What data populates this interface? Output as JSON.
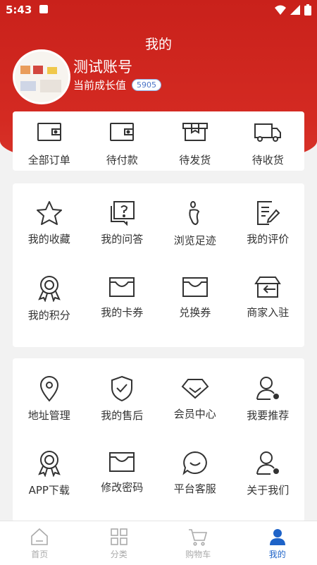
{
  "status": {
    "time": "5:43"
  },
  "header": {
    "title": "我的"
  },
  "profile": {
    "username": "测试账号",
    "growth_label": "当前成长值",
    "growth_value": "5905"
  },
  "orders": [
    {
      "label": "全部订单",
      "icon": "wallet-icon"
    },
    {
      "label": "待付款",
      "icon": "wallet-icon"
    },
    {
      "label": "待发货",
      "icon": "package-icon"
    },
    {
      "label": "待收货",
      "icon": "truck-icon"
    }
  ],
  "services1": [
    {
      "label": "我的收藏",
      "icon": "star-icon"
    },
    {
      "label": "我的问答",
      "icon": "question-icon"
    },
    {
      "label": "浏览足迹",
      "icon": "footprint-icon"
    },
    {
      "label": "我的评价",
      "icon": "edit-doc-icon"
    },
    {
      "label": "我的积分",
      "icon": "medal-icon"
    },
    {
      "label": "我的卡券",
      "icon": "coupon-icon"
    },
    {
      "label": "兑换券",
      "icon": "coupon-icon"
    },
    {
      "label": "商家入驻",
      "icon": "store-icon"
    }
  ],
  "services2": [
    {
      "label": "地址管理",
      "icon": "location-icon"
    },
    {
      "label": "我的售后",
      "icon": "shield-icon"
    },
    {
      "label": "会员中心",
      "icon": "diamond-icon"
    },
    {
      "label": "我要推荐",
      "icon": "user-share-icon"
    },
    {
      "label": "APP下载",
      "icon": "medal-icon"
    },
    {
      "label": "修改密码",
      "icon": "coupon-icon"
    },
    {
      "label": "平台客服",
      "icon": "chat-icon"
    },
    {
      "label": "关于我们",
      "icon": "user-share-icon"
    }
  ],
  "tabs": [
    {
      "label": "首页",
      "icon": "home-icon"
    },
    {
      "label": "分类",
      "icon": "grid-icon"
    },
    {
      "label": "购物车",
      "icon": "cart-icon"
    },
    {
      "label": "我的",
      "icon": "user-icon",
      "active": true
    }
  ],
  "colors": {
    "brand_red": "#d42a22",
    "active_blue": "#1e63c8",
    "icon_gray": "#333333"
  }
}
